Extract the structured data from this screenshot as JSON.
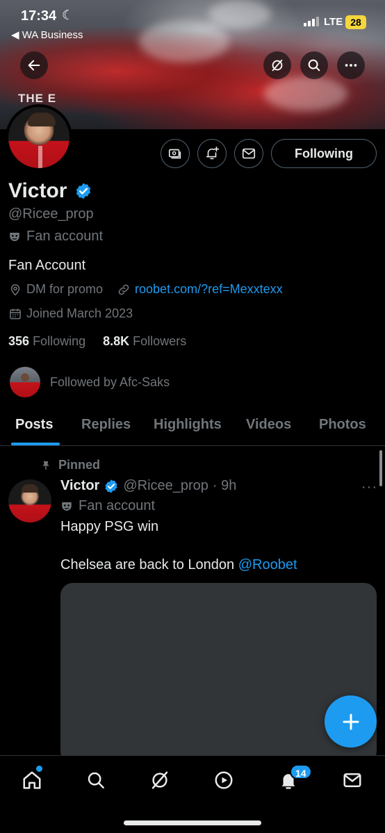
{
  "status_bar": {
    "time": "17:34",
    "back_app": "◀ WA Business",
    "network": "LTE",
    "battery": "28"
  },
  "banner": {
    "text": "THE E"
  },
  "profile": {
    "name": "Victor",
    "handle": "@Ricee_prop",
    "label": "Fan account",
    "bio": "Fan Account",
    "location": "DM for promo",
    "website": "roobet.com/?ref=Mexxtexx",
    "joined": "Joined March 2023",
    "following_count": "356",
    "following_label": "Following",
    "followers_count": "8.8K",
    "followers_label": "Followers",
    "followed_by": "Followed by Afc-Saks",
    "follow_button": "Following"
  },
  "tabs": [
    "Posts",
    "Replies",
    "Highlights",
    "Videos",
    "Photos"
  ],
  "post": {
    "pinned_label": "Pinned",
    "author_name": "Victor",
    "author_handle": "@Ricee_prop",
    "time": "· 9h",
    "author_label": "Fan account",
    "text_line1": "Happy PSG win",
    "text_line2": "Chelsea are back to London",
    "mention": "@Roobet",
    "more": "···"
  },
  "bottom_nav": {
    "notifications_badge": "14",
    "items": [
      "home-icon",
      "search-icon",
      "grok-icon",
      "video-icon",
      "notifications-icon",
      "messages-icon"
    ]
  },
  "colors": {
    "accent": "#1d9bf0",
    "background": "#000000",
    "muted_text": "#71767b",
    "primary_text": "#e7e9ea"
  }
}
